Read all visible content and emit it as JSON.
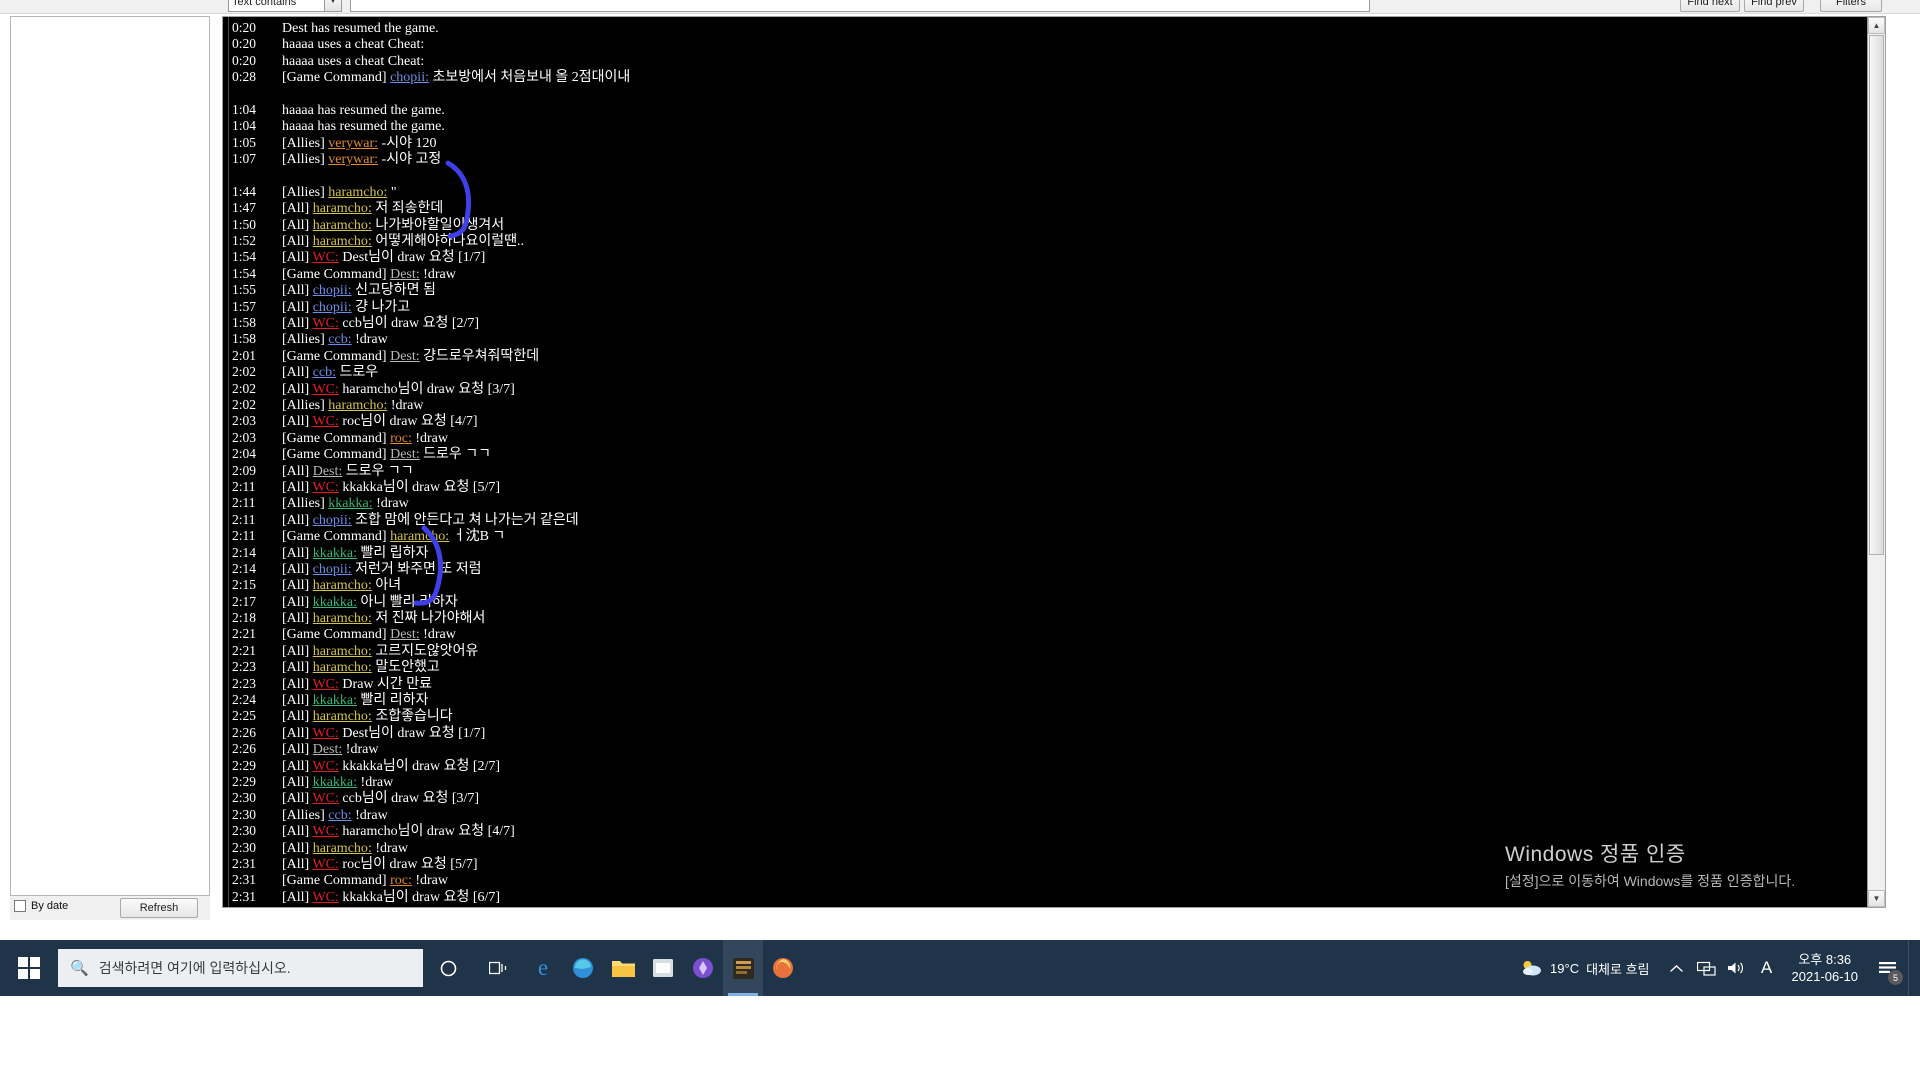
{
  "toolbar": {
    "filter_select_value": "Text contains",
    "search_value": "",
    "find_next_label": "Find next",
    "find_prev_label": "Find prev",
    "filters_label": "Filters",
    "combo_arrow_icon": "chevron-down-icon"
  },
  "left_panel": {
    "by_date_label": "By date",
    "by_date_checked": false,
    "refresh_label": "Refresh"
  },
  "scrollbar": {
    "up_icon": "chevron-up-icon",
    "down_icon": "chevron-down-icon"
  },
  "colors": {
    "background": "#000000",
    "nick_gold": "#d6c44a",
    "nick_orange": "#e08a2e",
    "nick_red": "#e02020",
    "nick_blue": "#6d8fe8",
    "nick_green": "#35b87a",
    "nick_gray": "#b9b9b9",
    "text_white": "#ffffff",
    "annotation_blue": "#4040e8",
    "taskbar": "#1f3349"
  },
  "chat": {
    "lines": [
      {
        "ts": "0:20",
        "chan": "",
        "nick": "",
        "nick_color": "",
        "msg": "Dest has resumed the game.",
        "msg_color": "white"
      },
      {
        "ts": "0:20",
        "chan": "",
        "nick": "",
        "nick_color": "",
        "msg": "haaaa uses a cheat Cheat:",
        "msg_color": "white"
      },
      {
        "ts": "0:20",
        "chan": "",
        "nick": "",
        "nick_color": "",
        "msg": "haaaa uses a cheat Cheat:",
        "msg_color": "white"
      },
      {
        "ts": "0:28",
        "chan": "[Game Command]",
        "nick": "chopii:",
        "nick_color": "blue",
        "msg": "초보방에서 처음보내 올 2점대이내",
        "msg_color": "white"
      },
      {
        "blank": true
      },
      {
        "ts": "1:04",
        "chan": "",
        "nick": "",
        "nick_color": "",
        "msg": "haaaa has resumed the game.",
        "msg_color": "white"
      },
      {
        "ts": "1:04",
        "chan": "",
        "nick": "",
        "nick_color": "",
        "msg": "haaaa has resumed the game.",
        "msg_color": "white"
      },
      {
        "ts": "1:05",
        "chan": "[Allies]",
        "nick": "verywar:",
        "nick_color": "orange",
        "msg": "-시야 120",
        "msg_color": "white"
      },
      {
        "ts": "1:07",
        "chan": "[Allies]",
        "nick": "verywar:",
        "nick_color": "orange",
        "msg": "-시야 고정",
        "msg_color": "white"
      },
      {
        "blank": true
      },
      {
        "ts": "1:44",
        "chan": "[Allies]",
        "nick": "haramcho:",
        "nick_color": "gold",
        "msg": "\"",
        "msg_color": "white"
      },
      {
        "ts": "1:47",
        "chan": "[All]",
        "nick": "haramcho:",
        "nick_color": "gold",
        "msg": "저 죄송한데",
        "msg_color": "white"
      },
      {
        "ts": "1:50",
        "chan": "[All]",
        "nick": "haramcho:",
        "nick_color": "gold",
        "msg": "나가봐야할일이생겨서",
        "msg_color": "white"
      },
      {
        "ts": "1:52",
        "chan": "[All]",
        "nick": "haramcho:",
        "nick_color": "gold",
        "msg": "어떻게해야하나요이럴땐..",
        "msg_color": "white"
      },
      {
        "ts": "1:54",
        "chan": "[All]",
        "nick": "WC:",
        "nick_color": "red",
        "msg": "Dest님이 draw 요청 [1/7]",
        "msg_color": "white"
      },
      {
        "ts": "1:54",
        "chan": "[Game Command]",
        "nick": "Dest:",
        "nick_color": "gray",
        "msg": "!draw",
        "msg_color": "white"
      },
      {
        "ts": "1:55",
        "chan": "[All]",
        "nick": "chopii:",
        "nick_color": "blue",
        "msg": "신고당하면 됨",
        "msg_color": "white"
      },
      {
        "ts": "1:57",
        "chan": "[All]",
        "nick": "chopii:",
        "nick_color": "blue",
        "msg": "걍 나가고",
        "msg_color": "white"
      },
      {
        "ts": "1:58",
        "chan": "[All]",
        "nick": "WC:",
        "nick_color": "red",
        "msg": "ccb님이 draw 요청 [2/7]",
        "msg_color": "white"
      },
      {
        "ts": "1:58",
        "chan": "[Allies]",
        "nick": "ccb:",
        "nick_color": "blue",
        "msg": "!draw",
        "msg_color": "white"
      },
      {
        "ts": "2:01",
        "chan": "[Game Command]",
        "nick": "Dest:",
        "nick_color": "gray",
        "msg": "걍드로우쳐줘딱한데",
        "msg_color": "white"
      },
      {
        "ts": "2:02",
        "chan": "[All]",
        "nick": "ccb:",
        "nick_color": "blue",
        "msg": "드로우",
        "msg_color": "white"
      },
      {
        "ts": "2:02",
        "chan": "[All]",
        "nick": "WC:",
        "nick_color": "red",
        "msg": "haramcho님이 draw 요청 [3/7]",
        "msg_color": "white"
      },
      {
        "ts": "2:02",
        "chan": "[Allies]",
        "nick": "haramcho:",
        "nick_color": "gold",
        "msg": "!draw",
        "msg_color": "white"
      },
      {
        "ts": "2:03",
        "chan": "[All]",
        "nick": "WC:",
        "nick_color": "red",
        "msg": "roc님이 draw 요청 [4/7]",
        "msg_color": "white"
      },
      {
        "ts": "2:03",
        "chan": "[Game Command]",
        "nick": "roc:",
        "nick_color": "orange",
        "msg": "!draw",
        "msg_color": "white"
      },
      {
        "ts": "2:04",
        "chan": "[Game Command]",
        "nick": "Dest:",
        "nick_color": "gray",
        "msg": "드로우 ㄱㄱ",
        "msg_color": "white"
      },
      {
        "ts": "2:09",
        "chan": "[All]",
        "nick": "Dest:",
        "nick_color": "gray",
        "msg": "드로우 ㄱㄱ",
        "msg_color": "white"
      },
      {
        "ts": "2:11",
        "chan": "[All]",
        "nick": "WC:",
        "nick_color": "red",
        "msg": "kkakka님이 draw 요청 [5/7]",
        "msg_color": "white"
      },
      {
        "ts": "2:11",
        "chan": "[Allies]",
        "nick": "kkakka:",
        "nick_color": "green",
        "msg": "!draw",
        "msg_color": "white"
      },
      {
        "ts": "2:11",
        "chan": "[All]",
        "nick": "chopii:",
        "nick_color": "blue",
        "msg": "조합 맘에 안든다고 쳐 나가는거 같은데",
        "msg_color": "white"
      },
      {
        "ts": "2:11",
        "chan": "[Game Command]",
        "nick": "haramcho:",
        "nick_color": "gold",
        "msg": "ㅓ沈B ㄱ",
        "msg_color": "white"
      },
      {
        "ts": "2:14",
        "chan": "[All]",
        "nick": "kkakka:",
        "nick_color": "green",
        "msg": "빨리 립하자",
        "msg_color": "white"
      },
      {
        "ts": "2:14",
        "chan": "[All]",
        "nick": "chopii:",
        "nick_color": "blue",
        "msg": "저런거 봐주면 또 저럼",
        "msg_color": "white"
      },
      {
        "ts": "2:15",
        "chan": "[All]",
        "nick": "haramcho:",
        "nick_color": "gold",
        "msg": "아녀",
        "msg_color": "white"
      },
      {
        "ts": "2:17",
        "chan": "[All]",
        "nick": "kkakka:",
        "nick_color": "green",
        "msg": "아니 빨리 리하자",
        "msg_color": "white"
      },
      {
        "ts": "2:18",
        "chan": "[All]",
        "nick": "haramcho:",
        "nick_color": "gold",
        "msg": "저 진짜 나가야해서",
        "msg_color": "white"
      },
      {
        "ts": "2:21",
        "chan": "[Game Command]",
        "nick": "Dest:",
        "nick_color": "gray",
        "msg": "!draw",
        "msg_color": "white"
      },
      {
        "ts": "2:21",
        "chan": "[All]",
        "nick": "haramcho:",
        "nick_color": "gold",
        "msg": "고르지도않앗어유",
        "msg_color": "white"
      },
      {
        "ts": "2:23",
        "chan": "[All]",
        "nick": "haramcho:",
        "nick_color": "gold",
        "msg": "말도안했고",
        "msg_color": "white"
      },
      {
        "ts": "2:23",
        "chan": "[All]",
        "nick": "WC:",
        "nick_color": "red",
        "msg": "Draw 시간 만료",
        "msg_color": "white"
      },
      {
        "ts": "2:24",
        "chan": "[All]",
        "nick": "kkakka:",
        "nick_color": "green",
        "msg": "빨리 리하자",
        "msg_color": "white"
      },
      {
        "ts": "2:25",
        "chan": "[All]",
        "nick": "haramcho:",
        "nick_color": "gold",
        "msg": "조합좋습니다",
        "msg_color": "white"
      },
      {
        "ts": "2:26",
        "chan": "[All]",
        "nick": "WC:",
        "nick_color": "red",
        "msg": "Dest님이 draw 요청 [1/7]",
        "msg_color": "white"
      },
      {
        "ts": "2:26",
        "chan": "[All]",
        "nick": "Dest:",
        "nick_color": "gray",
        "msg": "!draw",
        "msg_color": "white"
      },
      {
        "ts": "2:29",
        "chan": "[All]",
        "nick": "WC:",
        "nick_color": "red",
        "msg": "kkakka님이 draw 요청 [2/7]",
        "msg_color": "white"
      },
      {
        "ts": "2:29",
        "chan": "[All]",
        "nick": "kkakka:",
        "nick_color": "green",
        "msg": "!draw",
        "msg_color": "white"
      },
      {
        "ts": "2:30",
        "chan": "[All]",
        "nick": "WC:",
        "nick_color": "red",
        "msg": "ccb님이 draw 요청 [3/7]",
        "msg_color": "white"
      },
      {
        "ts": "2:30",
        "chan": "[Allies]",
        "nick": "ccb:",
        "nick_color": "blue",
        "msg": "!draw",
        "msg_color": "white"
      },
      {
        "ts": "2:30",
        "chan": "[All]",
        "nick": "WC:",
        "nick_color": "red",
        "msg": "haramcho님이 draw 요청 [4/7]",
        "msg_color": "white"
      },
      {
        "ts": "2:30",
        "chan": "[All]",
        "nick": "haramcho:",
        "nick_color": "gold",
        "msg": "!draw",
        "msg_color": "white"
      },
      {
        "ts": "2:31",
        "chan": "[All]",
        "nick": "WC:",
        "nick_color": "red",
        "msg": "roc님이 draw 요청 [5/7]",
        "msg_color": "white"
      },
      {
        "ts": "2:31",
        "chan": "[Game Command]",
        "nick": "roc:",
        "nick_color": "orange",
        "msg": "!draw",
        "msg_color": "white"
      },
      {
        "ts": "2:31",
        "chan": "[All]",
        "nick": "WC:",
        "nick_color": "red",
        "msg": "kkakka님이 draw 요청 [6/7]",
        "msg_color": "white"
      }
    ]
  },
  "watermark": {
    "title": "Windows 정품 인증",
    "subtitle": "[설정]으로 이동하여 Windows를 정품 인증합니다."
  },
  "taskbar": {
    "start_icon": "windows-logo-icon",
    "search_placeholder": "검색하려면 여기에 입력하십시오.",
    "search_icon": "search-icon",
    "cortana_icon": "cortana-circle-icon",
    "taskview_icon": "task-view-icon",
    "apps": [
      {
        "name": "edge-legacy-icon",
        "glyph": "e",
        "color": "#2f8fd8",
        "active": false
      },
      {
        "name": "edge-chromium-icon",
        "glyph": "◉",
        "color": "#39a0e0",
        "active": false
      },
      {
        "name": "file-explorer-icon",
        "glyph": "▤",
        "color": "#f0c040",
        "active": false
      },
      {
        "name": "microsoft-store-icon",
        "glyph": "▣",
        "color": "#d8d8d8",
        "active": false
      },
      {
        "name": "warcraft-app-icon",
        "glyph": "◆",
        "color": "#7a4fd0",
        "active": false
      },
      {
        "name": "replay-parser-icon",
        "glyph": "▦",
        "color": "#c8a060",
        "active": true
      },
      {
        "name": "firefox-icon",
        "glyph": "◑",
        "color": "#e8713c",
        "active": false
      }
    ],
    "tray": {
      "weather_temp": "19°C",
      "weather_desc": "대체로 흐림",
      "weather_icon": "partly-cloudy-icon",
      "overflow_icon": "chevron-up-icon",
      "network_icon": "network-icon",
      "volume_icon": "volume-icon",
      "ime_icon": "A",
      "time": "오후 8:36",
      "date": "2021-06-10",
      "notification_icon": "notification-icon",
      "notification_count": "5"
    }
  }
}
